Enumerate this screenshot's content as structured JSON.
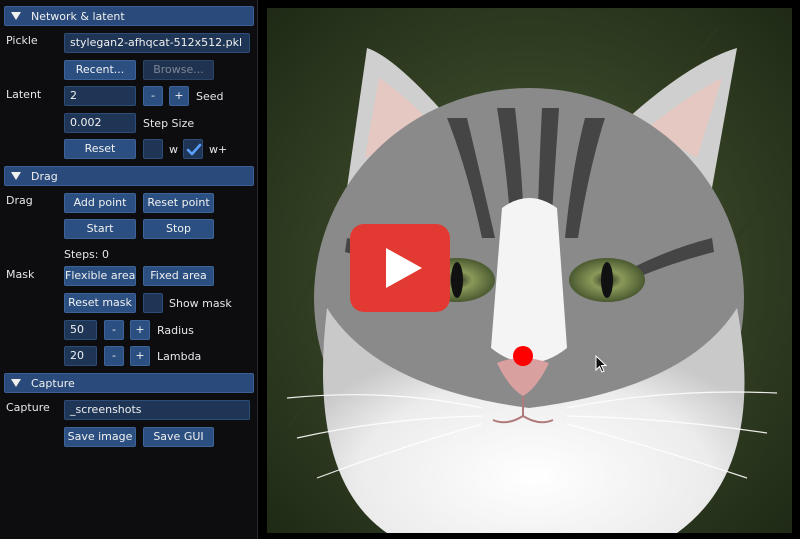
{
  "sections": {
    "network": "Network & latent",
    "drag": "Drag",
    "capture": "Capture"
  },
  "network": {
    "pickle_label": "Pickle",
    "pickle_value": "stylegan2-afhqcat-512x512.pkl",
    "recent_label": "Recent...",
    "browse_label": "Browse...",
    "latent_label": "Latent",
    "seed_value": "2",
    "minus": "-",
    "plus": "+",
    "seed_label": "Seed",
    "step_value": "0.002",
    "step_label": "Step Size",
    "reset_label": "Reset",
    "w_label": "w",
    "w_checked": false,
    "wplus_label": "w+",
    "wplus_checked": true
  },
  "drag": {
    "drag_label": "Drag",
    "add_point": "Add point",
    "reset_point": "Reset point",
    "start": "Start",
    "stop": "Stop",
    "steps": "Steps: 0",
    "mask_label": "Mask",
    "flexible_area": "Flexible area",
    "fixed_area": "Fixed area",
    "reset_mask": "Reset mask",
    "show_mask": "Show mask",
    "radius_value": "50",
    "radius_label": "Radius",
    "lambda_value": "20",
    "lambda_label": "Lambda",
    "minus": "-",
    "plus": "+"
  },
  "capture": {
    "capture_label": "Capture",
    "dir_value": "_screenshots",
    "save_image": "Save image",
    "save_gui": "Save GUI"
  },
  "colors": {
    "header": "#294a7a",
    "button": "#2a4f80",
    "field": "#1e3556",
    "play": "#e23a32",
    "drag_point": "#ff0000"
  }
}
